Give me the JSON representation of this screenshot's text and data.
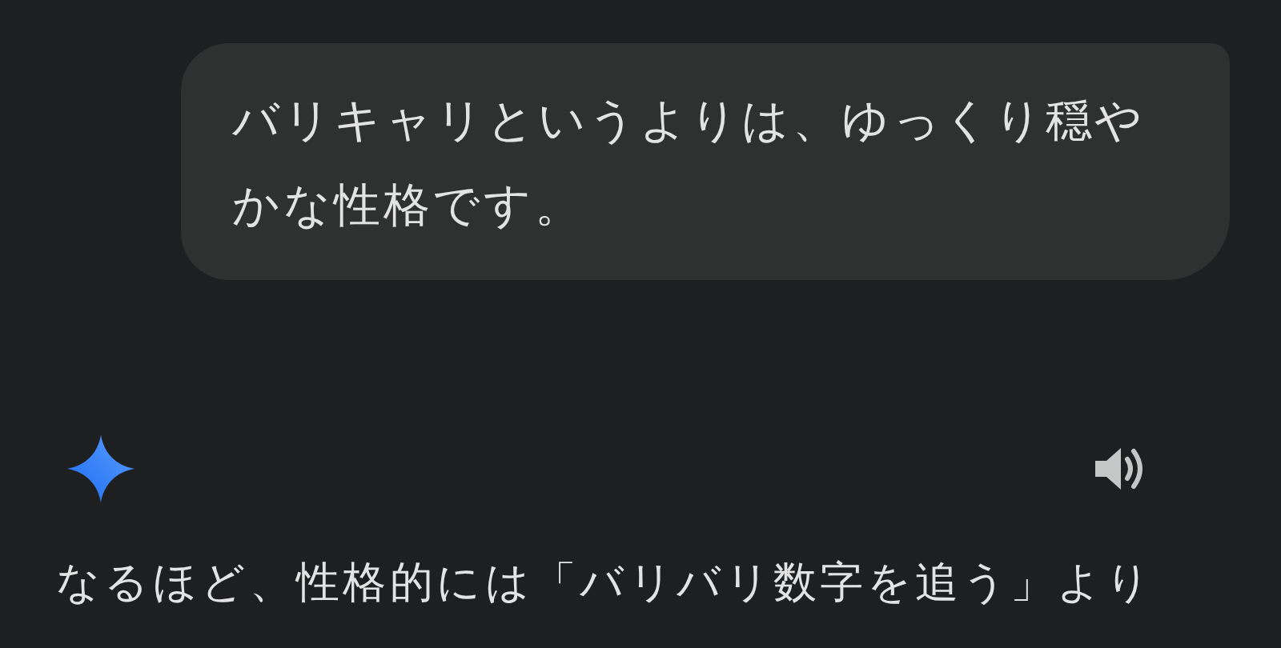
{
  "user_message": {
    "text": "バリキャリというよりは、ゆっくり穏やかな性格です。"
  },
  "response": {
    "text": "なるほど、性格的には「バリバリ数字を追う」より"
  }
}
